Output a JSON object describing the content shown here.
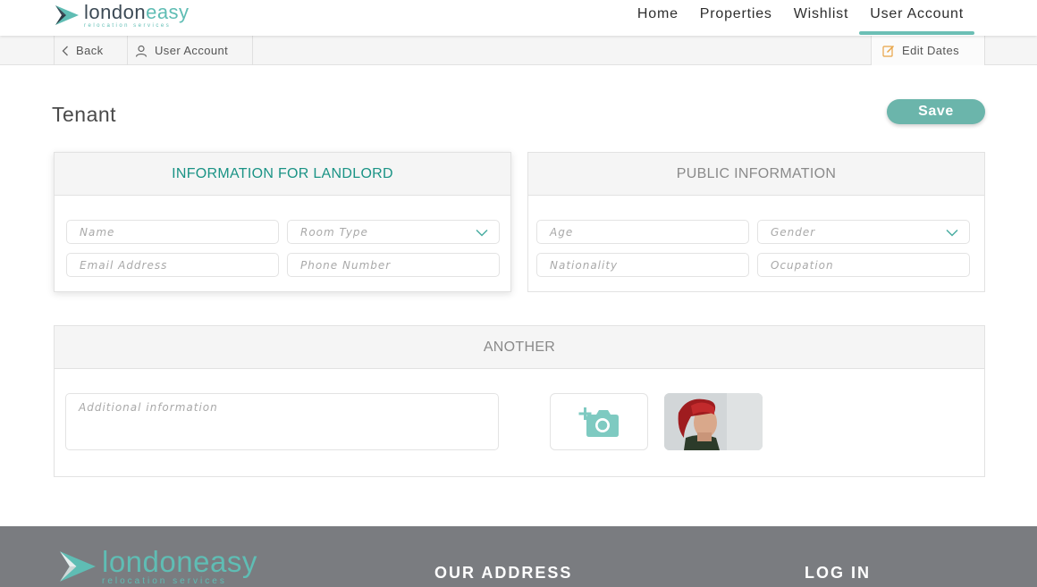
{
  "brand": {
    "name_part1": "london",
    "name_part2": "easy",
    "tagline": "relocation services"
  },
  "nav": {
    "items": [
      "Home",
      "Properties",
      "Wishlist",
      "User Account"
    ],
    "active": "User Account"
  },
  "subbar": {
    "back": "Back",
    "account": "User Account",
    "edit_dates": "Edit Dates"
  },
  "page": {
    "title": "Tenant",
    "save_label": "Save"
  },
  "landlord_panel": {
    "title": "INFORMATION FOR LANDLORD",
    "fields": {
      "name": "Name",
      "room_type": "Room Type",
      "email": "Email Address",
      "phone": "Phone Number"
    }
  },
  "public_panel": {
    "title": "PUBLIC INFORMATION",
    "fields": {
      "age": "Age",
      "gender": "Gender",
      "nationality": "Nationality",
      "occupation": "Ocupation"
    }
  },
  "another_panel": {
    "title": "ANOTHER",
    "additional_placeholder": "Additional information"
  },
  "footer": {
    "address_heading": "OUR ADDRESS",
    "login_heading": "LOG IN"
  },
  "colors": {
    "accent": "#6bb5ab",
    "teal_text": "#1a9385",
    "footer_bg": "#7a7c80"
  }
}
